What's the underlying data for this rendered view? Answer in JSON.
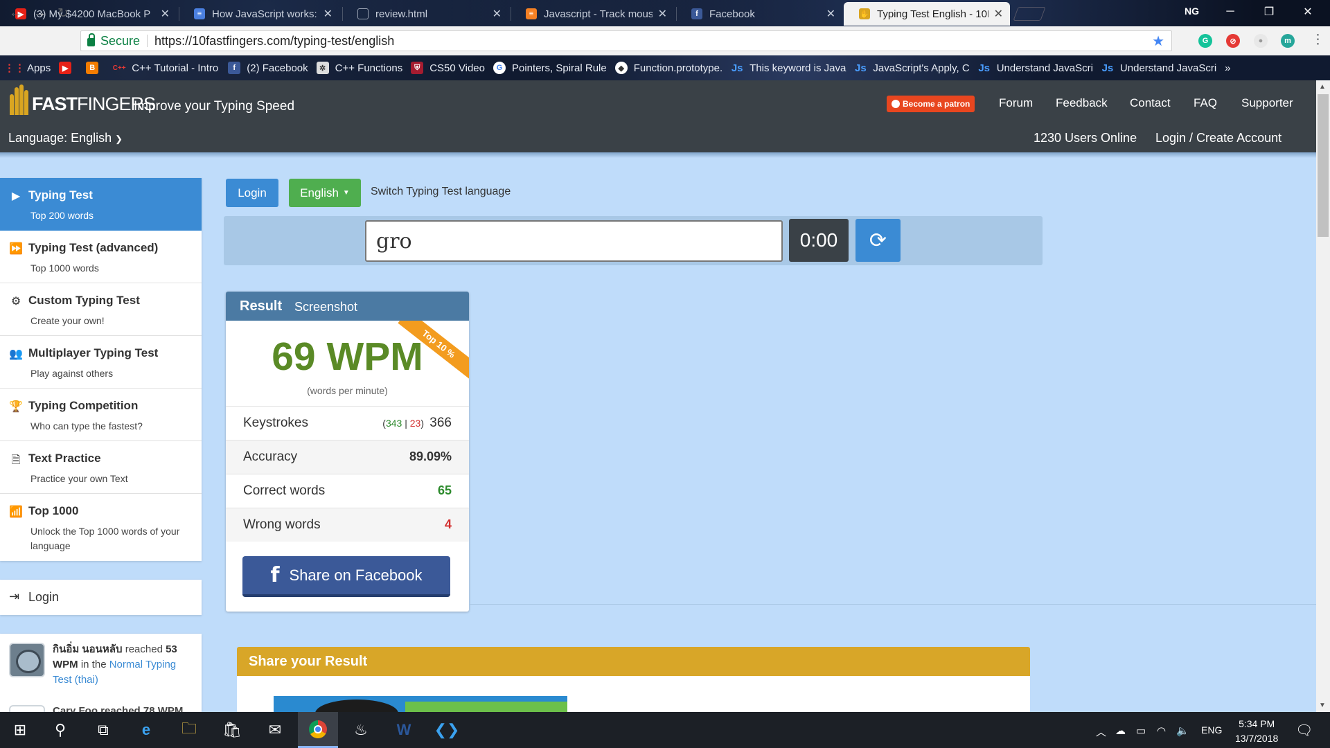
{
  "browser": {
    "tabs": [
      {
        "title": "(3) My $4200 MacBook P",
        "favicon": "youtube-icon"
      },
      {
        "title": "How JavaScript works: an",
        "favicon": "docs-icon"
      },
      {
        "title": "review.html",
        "favicon": "file-icon"
      },
      {
        "title": "Javascript - Track mouse",
        "favicon": "stackoverflow-icon"
      },
      {
        "title": "Facebook",
        "favicon": "facebook-icon"
      },
      {
        "title": "Typing Test English - 10F",
        "favicon": "10fastfingers-icon"
      }
    ],
    "profile_initials": "NG",
    "secure_label": "Secure",
    "url": "https://10fastfingers.com/typing-test/english",
    "bookmarks": [
      "Apps",
      "C++ Tutorial - Intro",
      "(2) Facebook",
      "C++ Functions",
      "CS50 Video",
      "Pointers, Spiral Rule",
      "Function.prototype.",
      "This keyword is Java",
      "JavaScript's Apply, C",
      "Understand JavaScri",
      "Understand JavaScri"
    ]
  },
  "site": {
    "logo_fast": "FAST",
    "logo_fingers": "FINGERS",
    "tagline": "Improve your Typing Speed",
    "patron_label": "Become a patron",
    "nav": [
      "Forum",
      "Feedback",
      "Contact",
      "FAQ",
      "Supporter"
    ],
    "language_label": "Language: English",
    "users_online": "1230 Users Online",
    "login_create": "Login / Create Account"
  },
  "menu": {
    "items": [
      {
        "title": "Typing Test",
        "subtitle": "Top 200 words",
        "icon": "play-icon"
      },
      {
        "title": "Typing Test (advanced)",
        "subtitle": "Top 1000 words",
        "icon": "fast-forward-icon"
      },
      {
        "title": "Custom Typing Test",
        "subtitle": "Create your own!",
        "icon": "gears-icon"
      },
      {
        "title": "Multiplayer Typing Test",
        "subtitle": "Play against others",
        "icon": "users-icon"
      },
      {
        "title": "Typing Competition",
        "subtitle": "Who can type the fastest?",
        "icon": "trophy-icon"
      },
      {
        "title": "Text Practice",
        "subtitle": "Practice your own Text",
        "icon": "document-icon"
      },
      {
        "title": "Top 1000",
        "subtitle": "Unlock the Top 1000 words of your language",
        "icon": "signal-bars-icon"
      }
    ],
    "login_label": "Login",
    "feed": {
      "user": "กินอิ่ม นอนหลับ",
      "reached": "reached",
      "wpm": "53 WPM",
      "in_the": "in the",
      "test_link": "Normal Typing Test (thai)",
      "next_user_partial": "Cary Foo reached 78 WPM"
    }
  },
  "controls": {
    "login_button": "Login",
    "language_button": "English",
    "switch_label": "Switch Typing Test language",
    "input_value": "gro",
    "timer": "0:00"
  },
  "result": {
    "title": "Result",
    "screenshot_label": "Screenshot",
    "wpm": "69 WPM",
    "wpm_caption": "(words per minute)",
    "ribbon": "Top 10 %",
    "keystrokes_label": "Keystrokes",
    "keystrokes_correct": "343",
    "keystrokes_wrong": "23",
    "keystrokes_total": "366",
    "accuracy_label": "Accuracy",
    "accuracy_value": "89.09%",
    "correct_label": "Correct words",
    "correct_value": "65",
    "wrong_label": "Wrong words",
    "wrong_value": "4",
    "share_facebook": "Share on Facebook"
  },
  "share": {
    "title": "Share your Result"
  },
  "taskbar": {
    "lang": "ENG",
    "time": "5:34 PM",
    "date": "13/7/2018"
  },
  "colors": {
    "accent_blue": "#3b8bd4",
    "header_dark": "#3a4147",
    "wpm_green": "#5a8a26",
    "share_gold": "#d8a628",
    "facebook_blue": "#3b5998"
  }
}
